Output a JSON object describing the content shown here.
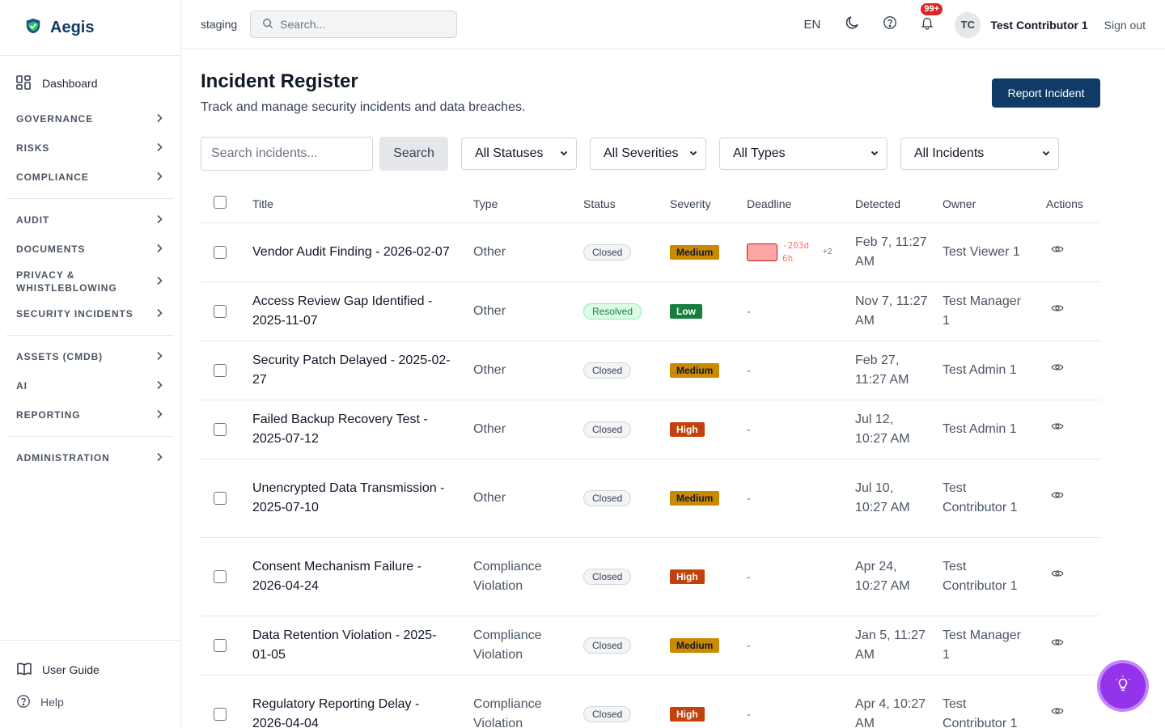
{
  "brand": {
    "name": "Aegis"
  },
  "sidebar": {
    "dashboard": "Dashboard",
    "groups": [
      [
        "GOVERNANCE",
        "RISKS",
        "COMPLIANCE"
      ],
      [
        "AUDIT",
        "DOCUMENTS",
        "PRIVACY & WHISTLEBLOWING",
        "SECURITY INCIDENTS"
      ],
      [
        "ASSETS (CMDB)",
        "AI",
        "REPORTING"
      ],
      [
        "ADMINISTRATION"
      ]
    ],
    "user_guide": "User Guide",
    "help": "Help"
  },
  "topbar": {
    "env": "staging",
    "search_placeholder": "Search...",
    "lang": "EN",
    "notif_count": "99+",
    "avatar": "TC",
    "user": "Test Contributor 1",
    "signout": "Sign out"
  },
  "page": {
    "title": "Incident Register",
    "subtitle": "Track and manage security incidents and data breaches.",
    "report_button": "Report Incident"
  },
  "filters": {
    "search_placeholder": "Search incidents...",
    "search_button": "Search",
    "status": "All Statuses",
    "severity": "All Severities",
    "type": "All Types",
    "scope": "All Incidents"
  },
  "table": {
    "columns": [
      "Title",
      "Type",
      "Status",
      "Severity",
      "Deadline",
      "Detected",
      "Owner",
      "Actions"
    ],
    "rows": [
      {
        "title": "Vendor Audit Finding - 2026-02-07",
        "type": "Other",
        "status": "Closed",
        "severity": "Medium",
        "deadline": "-203d 6h",
        "deadline_more": "+2",
        "detected": "Feb 7, 11:27 AM",
        "owner": "Test Viewer 1"
      },
      {
        "title": "Access Review Gap Identified - 2025-11-07",
        "type": "Other",
        "status": "Resolved",
        "severity": "Low",
        "deadline": "-",
        "detected": "Nov 7, 11:27 AM",
        "owner": "Test Manager 1"
      },
      {
        "title": "Security Patch Delayed - 2025-02-27",
        "type": "Other",
        "status": "Closed",
        "severity": "Medium",
        "deadline": "-",
        "detected": "Feb 27, 11:27 AM",
        "owner": "Test Admin 1"
      },
      {
        "title": "Failed Backup Recovery Test - 2025-07-12",
        "type": "Other",
        "status": "Closed",
        "severity": "High",
        "deadline": "-",
        "detected": "Jul 12, 10:27 AM",
        "owner": "Test Admin 1"
      },
      {
        "title": "Unencrypted Data Transmission - 2025-07-10",
        "type": "Other",
        "status": "Closed",
        "severity": "Medium",
        "deadline": "-",
        "detected": "Jul 10, 10:27 AM",
        "owner": "Test Contributor 1"
      },
      {
        "title": "Consent Mechanism Failure - 2026-04-24",
        "type": "Compliance Violation",
        "status": "Closed",
        "severity": "High",
        "deadline": "-",
        "detected": "Apr 24, 10:27 AM",
        "owner": "Test Contributor 1"
      },
      {
        "title": "Data Retention Violation - 2025-01-05",
        "type": "Compliance Violation",
        "status": "Closed",
        "severity": "Medium",
        "deadline": "-",
        "detected": "Jan 5, 11:27 AM",
        "owner": "Test Manager 1"
      },
      {
        "title": "Regulatory Reporting Delay - 2026-04-04",
        "type": "Compliance Violation",
        "status": "Closed",
        "severity": "High",
        "deadline": "-",
        "detected": "Apr 4, 10:27 AM",
        "owner": "Test Contributor 1"
      }
    ]
  }
}
